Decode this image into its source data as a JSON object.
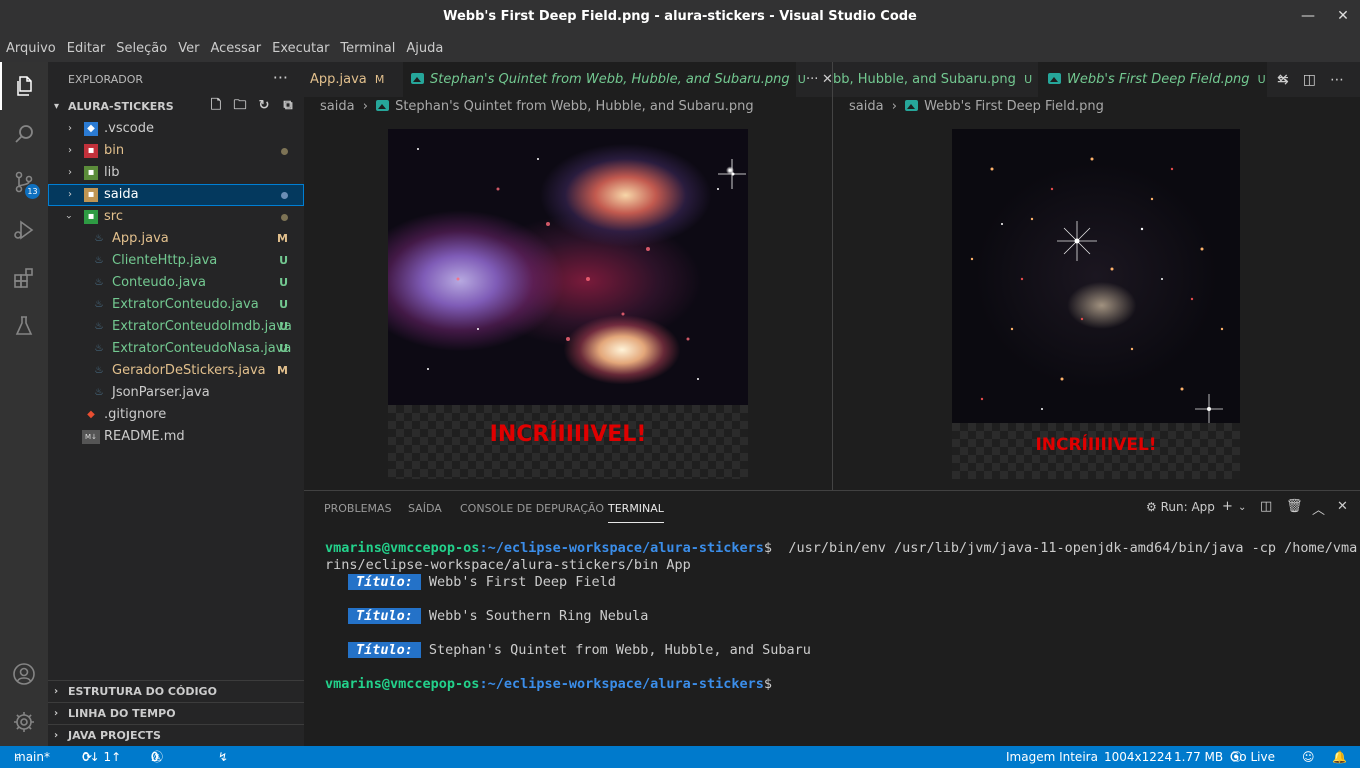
{
  "window": {
    "title": "Webb's First Deep Field.png - alura-stickers - Visual Studio Code",
    "minimize": "—",
    "close": "✕"
  },
  "menu": [
    "Arquivo",
    "Editar",
    "Seleção",
    "Ver",
    "Acessar",
    "Executar",
    "Terminal",
    "Ajuda"
  ],
  "activity": {
    "scm_badge": "13"
  },
  "explorer": {
    "header": "EXPLORADOR",
    "more": "···",
    "root": "ALURA-STICKERS",
    "items": [
      {
        "label": ".vscode",
        "status": ""
      },
      {
        "label": "bin",
        "status": "dot"
      },
      {
        "label": "lib",
        "status": ""
      },
      {
        "label": "saida",
        "status": "dot"
      },
      {
        "label": "src",
        "status": "dot"
      },
      {
        "label": "App.java",
        "status": "M"
      },
      {
        "label": "ClienteHttp.java",
        "status": "U"
      },
      {
        "label": "Conteudo.java",
        "status": "U"
      },
      {
        "label": "ExtratorConteudo.java",
        "status": "U"
      },
      {
        "label": "ExtratorConteudoImdb.java",
        "status": "U"
      },
      {
        "label": "ExtratorConteudoNasa.java",
        "status": "U"
      },
      {
        "label": "GeradorDeStickers.java",
        "status": "M"
      },
      {
        "label": "JsonParser.java",
        "status": ""
      },
      {
        "label": ".gitignore",
        "status": ""
      },
      {
        "label": "README.md",
        "status": ""
      }
    ],
    "sections": [
      "ESTRUTURA DO CÓDIGO",
      "LINHA DO TEMPO",
      "JAVA PROJECTS"
    ]
  },
  "editor1": {
    "tab1": {
      "label": "App.java",
      "status": "M"
    },
    "tab2": {
      "label": "Stephan's Quintet from Webb, Hubble, and Subaru.png",
      "status": "U"
    },
    "more": "···",
    "crumb_folder": "saida",
    "crumb_sep": "›",
    "crumb_file": "Stephan's Quintet from Webb, Hubble, and Subaru.png",
    "sticker": "INCRÍIIIIVEL!"
  },
  "editor2": {
    "tab1": {
      "label": "bb, Hubble, and Subaru.png",
      "status": "U"
    },
    "tab2": {
      "label": "Webb's First Deep Field.png",
      "status": "U"
    },
    "close": "✕",
    "crumb_folder": "saida",
    "crumb_sep": "›",
    "crumb_file": "Webb's First Deep Field.png",
    "sticker": "INCRÍIIIIVEL!"
  },
  "panel": {
    "tabs": [
      "PROBLEMAS",
      "SAÍDA",
      "CONSOLE DE DEPURAÇÃO",
      "TERMINAL"
    ],
    "run_label": "Run: App",
    "terminal": {
      "user": "vmarins@vmccepop-os",
      "path": ":~/eclipse-workspace/alura-stickers",
      "prompt": "$",
      "command_1": "  /usr/bin/env /usr/lib/jvm/java-11-openjdk-amd64/bin/java -cp /home/vma",
      "command_2": "rins/eclipse-workspace/alura-stickers/bin App",
      "badge": "Título:",
      "titles": [
        "Webb's First Deep Field",
        "Webb's Southern Ring Nebula",
        "Stephan's Quintet from Webb, Hubble, and Subaru"
      ]
    }
  },
  "status": {
    "branch": "main*",
    "sync": "0↓ 1↑",
    "errors": "0",
    "warnings": "0",
    "view": "Imagem Inteira",
    "dimensions": "1004x1224",
    "size": "1.77 MB",
    "golive": "Go Live"
  }
}
